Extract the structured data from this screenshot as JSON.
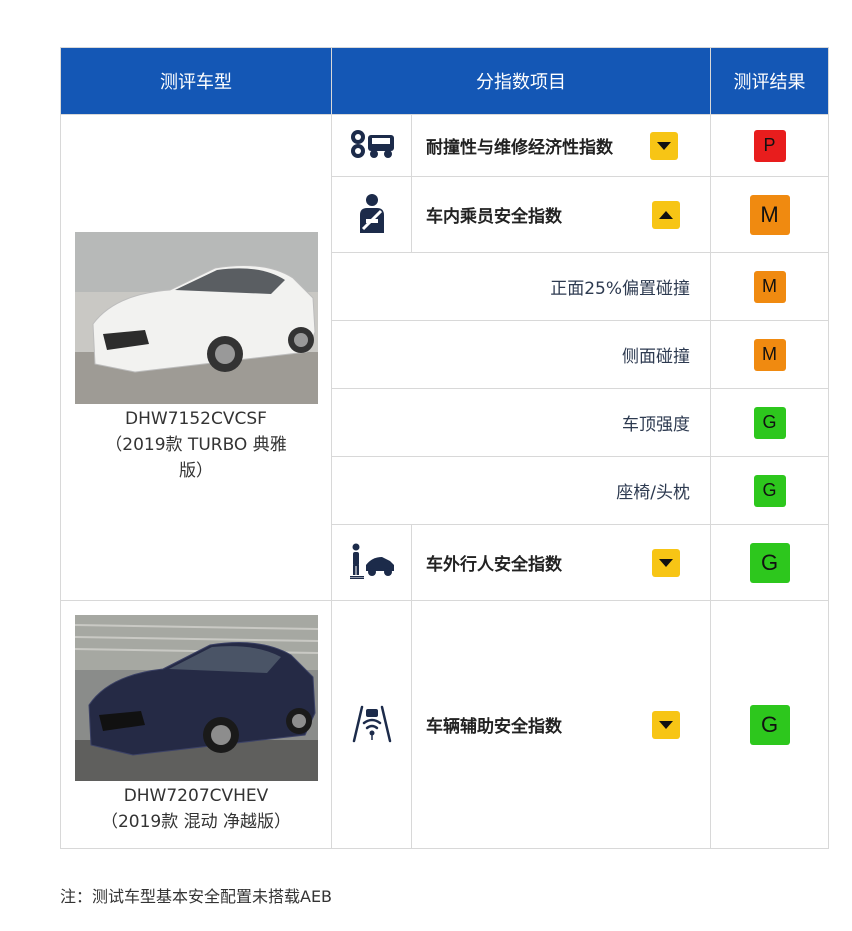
{
  "header": {
    "col_model": "测评车型",
    "col_index": "分指数项目",
    "col_result": "测评结果"
  },
  "colors": {
    "header_bg": "#1457b5",
    "grade_P": "#e81d1d",
    "grade_M": "#f08a10",
    "grade_G": "#2dc71d",
    "arrow_bg": "#f7c515"
  },
  "models": [
    {
      "code": "DHW7152CVCSF",
      "desc_line1": "（2019款 TURBO 典雅",
      "desc_line2": "版）",
      "image": "white-sedan-photo"
    },
    {
      "code": "DHW7207CVHEV",
      "desc_line1": "（2019款 混动 净越版）",
      "image": "dark-blue-sedan-photo"
    }
  ],
  "rows": {
    "durability": {
      "icon": "gears-car-icon",
      "label": "耐撞性与维修经济性指数",
      "arrow": "down",
      "grade": "P"
    },
    "occupant": {
      "icon": "seatbelt-person-icon",
      "label": "车内乘员安全指数",
      "arrow": "up",
      "grade": "M"
    },
    "sub_frontal": {
      "label": "正面25%偏置碰撞",
      "grade": "M"
    },
    "sub_side": {
      "label": "侧面碰撞",
      "grade": "M"
    },
    "sub_roof": {
      "label": "车顶强度",
      "grade": "G"
    },
    "sub_seat": {
      "label": "座椅/头枕",
      "grade": "G"
    },
    "pedestrian": {
      "icon": "pedestrian-car-icon",
      "label": "车外行人安全指数",
      "arrow": "down",
      "grade": "G"
    },
    "assist": {
      "icon": "lane-assist-icon",
      "label": "车辆辅助安全指数",
      "arrow": "down",
      "grade": "G"
    }
  },
  "note": "注：测试车型基本安全配置未搭载AEB"
}
